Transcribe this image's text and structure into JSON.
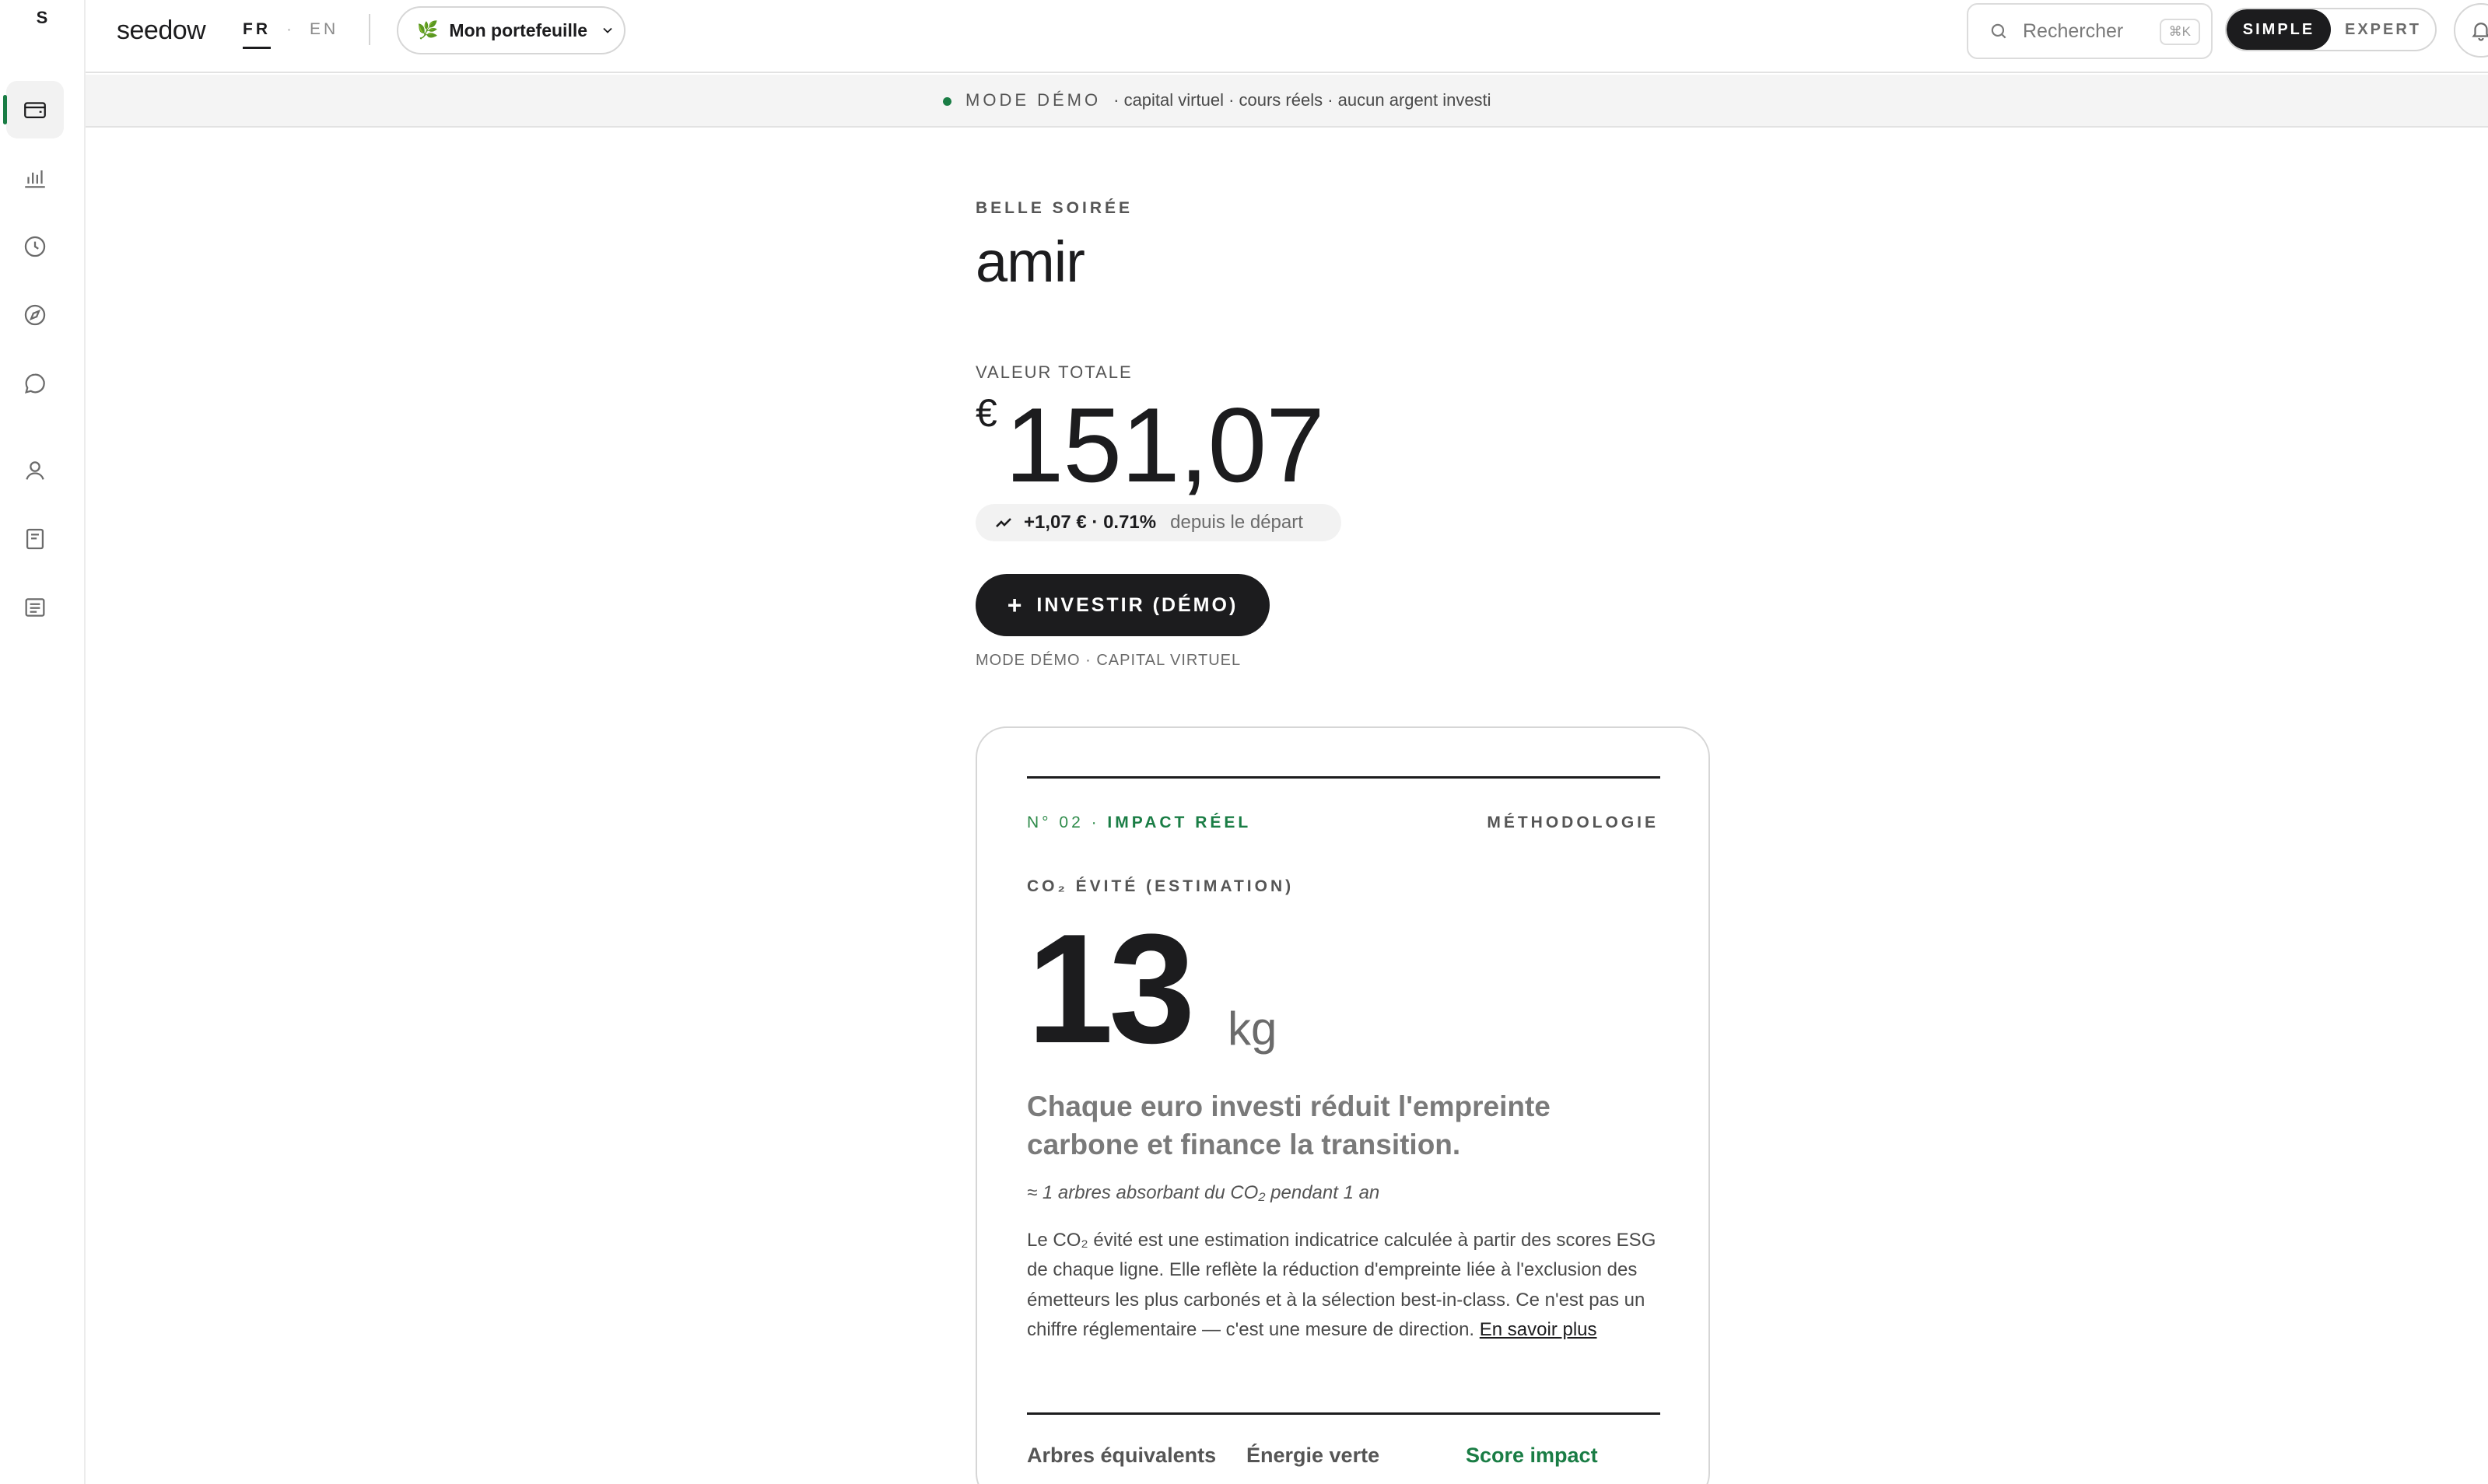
{
  "sidebar": {
    "logo": "S",
    "items": [
      {
        "icon": "wallet-icon",
        "active": true
      },
      {
        "icon": "bar-chart-icon",
        "active": false
      },
      {
        "icon": "clock-icon",
        "active": false
      },
      {
        "icon": "compass-icon",
        "active": false
      },
      {
        "icon": "chat-icon",
        "active": false
      },
      {
        "icon": "user-icon",
        "active": false
      },
      {
        "icon": "book-icon",
        "active": false
      },
      {
        "icon": "document-icon",
        "active": false
      }
    ]
  },
  "header": {
    "brand": "seedow",
    "lang_fr": "FR",
    "lang_sep": "·",
    "lang_en": "EN",
    "portfolio_label": "Mon portefeuille",
    "search_placeholder": "Rechercher",
    "search_shortcut": "⌘K",
    "mode_simple": "SIMPLE",
    "mode_expert": "EXPERT"
  },
  "banner": {
    "mode": "MODE DÉMO",
    "text": "· capital virtuel · cours réels · aucun argent investi"
  },
  "main": {
    "greeting": "BELLE SOIRÉE",
    "username": "amir",
    "total_label": "VALEUR TOTALE",
    "currency": "€",
    "total_value": "151,07",
    "delta_value": "+1,07 € · 0.71%",
    "delta_since": "depuis le départ",
    "invest_label": "INVESTIR (DÉMO)",
    "demo_note": "MODE DÉMO · CAPITAL VIRTUEL"
  },
  "impact_card": {
    "kicker_number": "N° 02 · ",
    "kicker_title": "IMPACT RÉEL",
    "methodology": "MÉTHODOLOGIE",
    "co2_label": "CO₂ ÉVITÉ (ESTIMATION)",
    "co2_value": "13",
    "co2_unit": "kg",
    "headline": "Chaque euro investi réduit l'empreinte carbone et finance la transition.",
    "approx": "≈ 1 arbres absorbant du CO₂ pendant 1 an",
    "description": "Le CO₂ évité est une estimation indicatrice calculée à partir des scores ESG de chaque ligne. Elle reflète la réduction d'empreinte liée à l'exclusion des émetteurs les plus carbonés et à la sélection best-in-class. Ce n'est pas un chiffre réglementaire — c'est une mesure de direction. ",
    "learn_more": "En savoir plus",
    "stats": [
      "Arbres équivalents",
      "Énergie verte",
      "Score impact"
    ]
  },
  "colors": {
    "accent_green": "#1a7d45",
    "dark": "#1c1c1e"
  }
}
